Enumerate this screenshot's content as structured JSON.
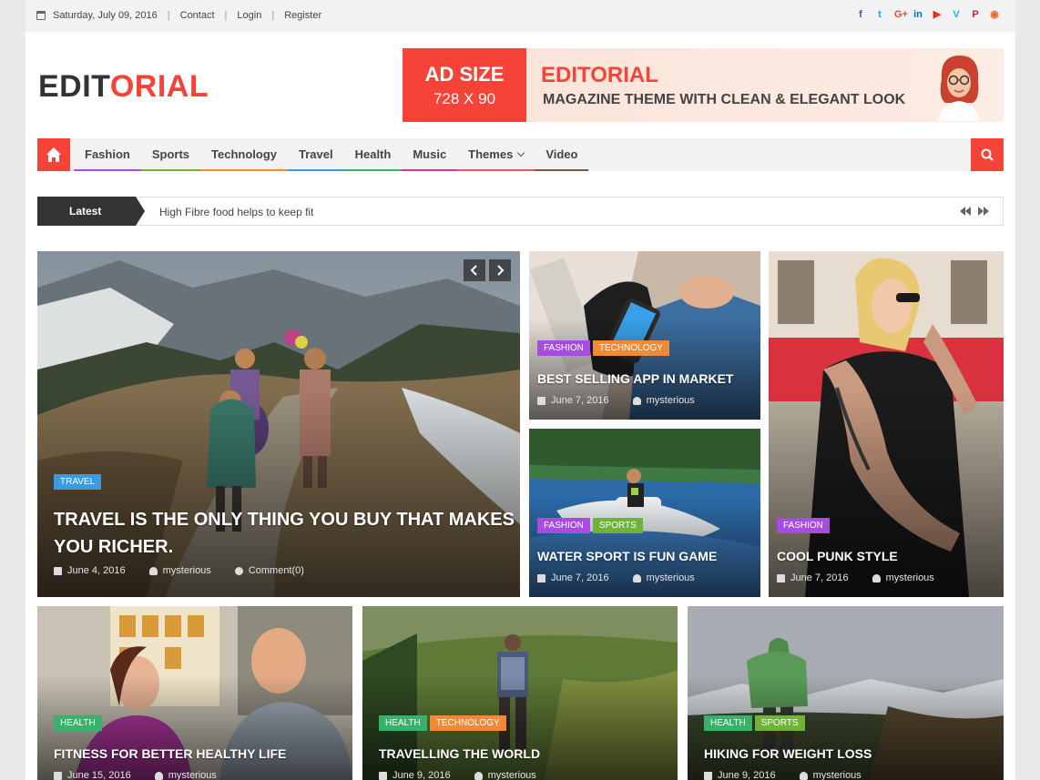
{
  "topbar": {
    "date": "Saturday, July 09, 2016",
    "links": [
      "Contact",
      "Login",
      "Register"
    ],
    "social_icons": [
      {
        "name": "facebook-icon",
        "glyph": "f",
        "color": "#3b5998"
      },
      {
        "name": "twitter-icon",
        "glyph": "t",
        "color": "#1da1f2"
      },
      {
        "name": "google-plus-icon",
        "glyph": "G+",
        "color": "#dd4b39"
      },
      {
        "name": "linkedin-icon",
        "glyph": "in",
        "color": "#0077b5"
      },
      {
        "name": "youtube-icon",
        "glyph": "▶",
        "color": "#e52d27"
      },
      {
        "name": "vimeo-icon",
        "glyph": "V",
        "color": "#1ab7ea"
      },
      {
        "name": "pinterest-icon",
        "glyph": "P",
        "color": "#cb2027"
      },
      {
        "name": "rss-icon",
        "glyph": "◉",
        "color": "#f26522"
      }
    ]
  },
  "logo": {
    "part1": "EDIT",
    "part2": "ORIAL"
  },
  "ad": {
    "size_title": "AD SIZE",
    "size_dims": "728 X 90",
    "headline": "EDITORIAL",
    "subline": "MAGAZINE THEME WITH CLEAN & ELEGANT LOOK"
  },
  "nav": {
    "items": [
      {
        "label": "Fashion",
        "color": "#a64ce0"
      },
      {
        "label": "Sports",
        "color": "#6fb33b"
      },
      {
        "label": "Technology",
        "color": "#f08a36"
      },
      {
        "label": "Travel",
        "color": "#3a9be0"
      },
      {
        "label": "Health",
        "color": "#38b26b"
      },
      {
        "label": "Music",
        "color": "#c23b9c"
      },
      {
        "label": "Themes",
        "color": "#e85a5a"
      },
      {
        "label": "Video",
        "color": "#7a5a3a"
      }
    ]
  },
  "ticker": {
    "label": "Latest",
    "headline": "High Fibre food helps to keep fit"
  },
  "featured": {
    "tags": [
      "TRAVEL"
    ],
    "title_line1": "TRAVEL IS THE ONLY THING YOU BUY THAT MAKES",
    "title_line2": "YOU RICHER.",
    "date": "June 4, 2016",
    "author": "mysterious",
    "comments": "Comment(0)"
  },
  "grid_top": [
    {
      "tags": [
        "FASHION",
        "TECHNOLOGY"
      ],
      "title": "BEST SELLING APP IN MARKET",
      "date": "June 7, 2016",
      "author": "mysterious"
    },
    {
      "tags": [
        "FASHION",
        "SPORTS"
      ],
      "title": "WATER SPORT IS FUN GAME",
      "date": "June 7, 2016",
      "author": "mysterious"
    },
    {
      "tags": [
        "FASHION"
      ],
      "title": "COOL PUNK STYLE",
      "date": "June 7, 2016",
      "author": "mysterious"
    }
  ],
  "grid_bottom": [
    {
      "tags": [
        "HEALTH"
      ],
      "title": "FITNESS FOR BETTER HEALTHY LIFE",
      "date": "June 15, 2016",
      "author": "mysterious"
    },
    {
      "tags": [
        "HEALTH",
        "TECHNOLOGY"
      ],
      "title": "TRAVELLING THE WORLD",
      "date": "June 9, 2016",
      "author": "mysterious"
    },
    {
      "tags": [
        "HEALTH",
        "SPORTS"
      ],
      "title": "HIKING FOR WEIGHT LOSS",
      "date": "June 9, 2016",
      "author": "mysterious"
    }
  ],
  "tag_colors": {
    "TRAVEL": "#3a9be0",
    "FASHION": "#a64ce0",
    "TECHNOLOGY": "#f08a36",
    "SPORTS": "#6fb33b",
    "HEALTH": "#38b26b"
  }
}
